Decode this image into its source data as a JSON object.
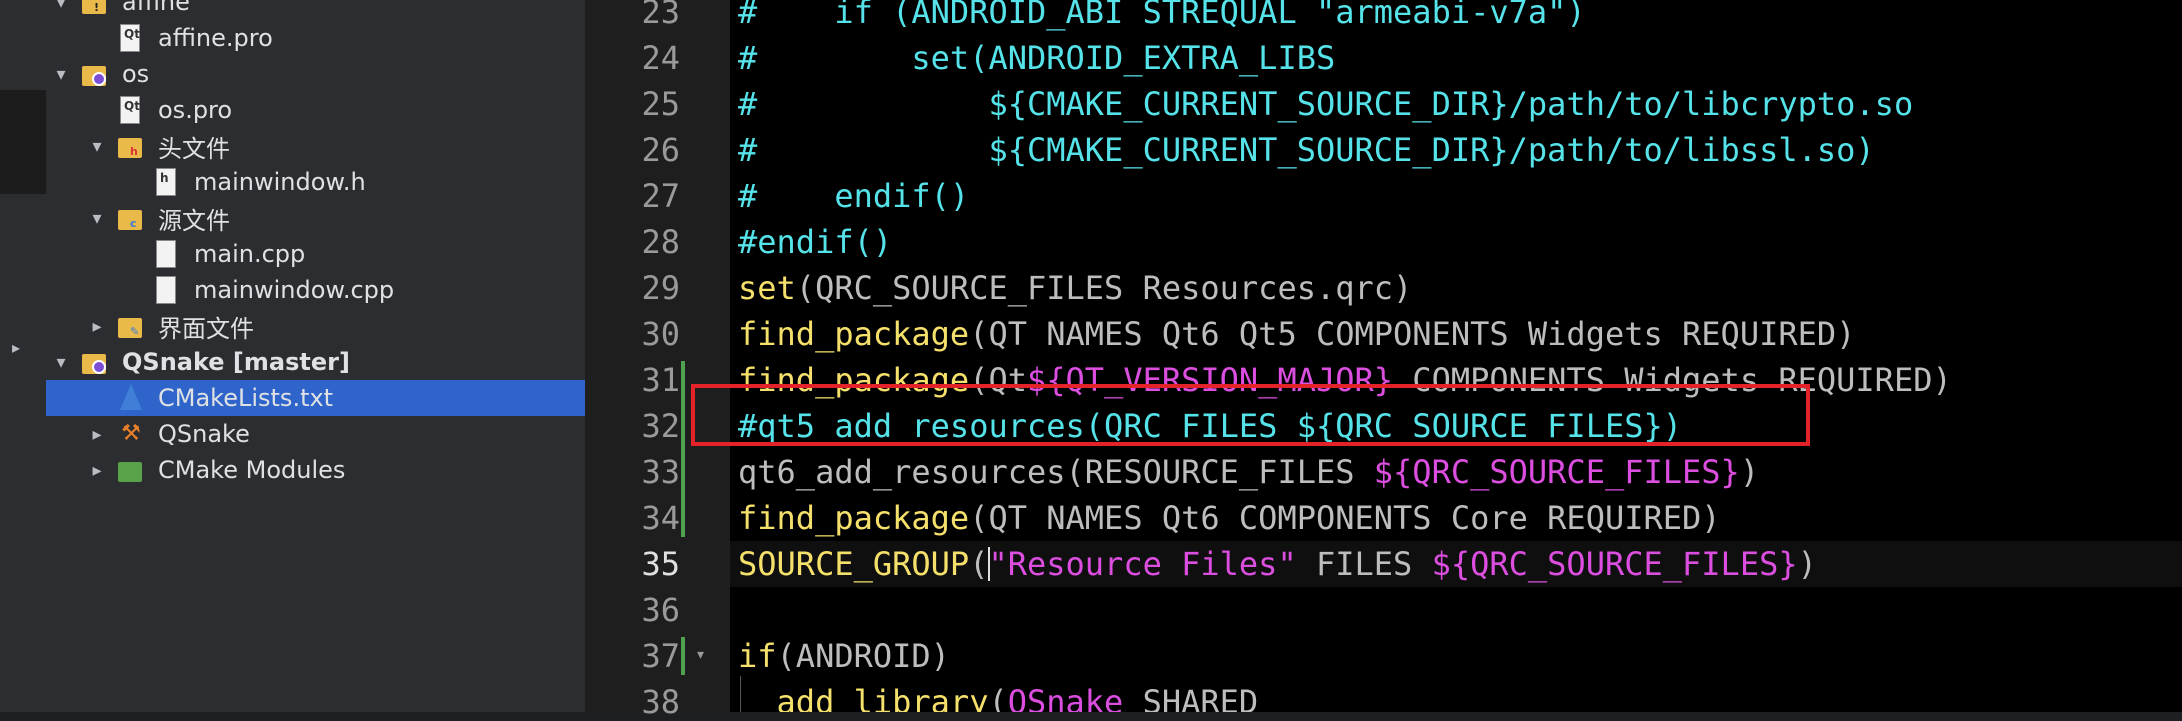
{
  "project_tree": {
    "items": [
      {
        "label": "affine",
        "icon": "folder-warning-icon",
        "arrow": "▾",
        "indent": 0,
        "bold": false
      },
      {
        "label": "affine.pro",
        "icon": "qt-project-file-icon",
        "arrow": "",
        "indent": 1,
        "bold": false
      },
      {
        "label": "os",
        "icon": "project-icon",
        "arrow": "▾",
        "indent": 0,
        "bold": false
      },
      {
        "label": "os.pro",
        "icon": "qt-project-file-icon",
        "arrow": "",
        "indent": 1,
        "bold": false
      },
      {
        "label": "头文件",
        "icon": "header-folder-icon",
        "arrow": "▾",
        "indent": 1,
        "bold": false
      },
      {
        "label": "mainwindow.h",
        "icon": "header-file-icon",
        "arrow": "",
        "indent": 2,
        "bold": false
      },
      {
        "label": "源文件",
        "icon": "source-folder-icon",
        "arrow": "▾",
        "indent": 1,
        "bold": false
      },
      {
        "label": "main.cpp",
        "icon": "cpp-file-icon",
        "arrow": "",
        "indent": 2,
        "bold": false
      },
      {
        "label": "mainwindow.cpp",
        "icon": "cpp-file-icon",
        "arrow": "",
        "indent": 2,
        "bold": false
      },
      {
        "label": "界面文件",
        "icon": "forms-folder-icon",
        "arrow": "▸",
        "indent": 1,
        "bold": false
      },
      {
        "label": "QSnake [master]",
        "icon": "project-icon",
        "arrow": "▾",
        "indent": 0,
        "bold": true
      },
      {
        "label": "CMakeLists.txt",
        "icon": "cmake-file-icon",
        "arrow": "",
        "indent": 1,
        "bold": false,
        "selected": true
      },
      {
        "label": "QSnake",
        "icon": "hammer-icon",
        "arrow": "▸",
        "indent": 1,
        "bold": false
      },
      {
        "label": "CMake Modules",
        "icon": "cmake-modules-icon",
        "arrow": "▸",
        "indent": 1,
        "bold": false
      }
    ]
  },
  "editor": {
    "current_line": 35,
    "lines": [
      {
        "num": "23",
        "tokens": [
          {
            "t": "#    if (ANDROID_ABI STREQUAL \"armeabi-v7a\")",
            "c": "cm"
          }
        ]
      },
      {
        "num": "24",
        "tokens": [
          {
            "t": "#        set(ANDROID_EXTRA_LIBS",
            "c": "cm"
          }
        ]
      },
      {
        "num": "25",
        "tokens": [
          {
            "t": "#            ${CMAKE_CURRENT_SOURCE_DIR}/path/to/libcrypto.so",
            "c": "cm"
          }
        ]
      },
      {
        "num": "26",
        "tokens": [
          {
            "t": "#            ${CMAKE_CURRENT_SOURCE_DIR}/path/to/libssl.so)",
            "c": "cm"
          }
        ]
      },
      {
        "num": "27",
        "tokens": [
          {
            "t": "#    endif()",
            "c": "cm"
          }
        ]
      },
      {
        "num": "28",
        "tokens": [
          {
            "t": "#endif()",
            "c": "cm"
          }
        ]
      },
      {
        "num": "29",
        "tokens": [
          {
            "t": "set",
            "c": "kw"
          },
          {
            "t": "(QRC_SOURCE_FILES Resources.qrc)",
            "c": "pl"
          }
        ]
      },
      {
        "num": "30",
        "tokens": [
          {
            "t": "find_package",
            "c": "kw"
          },
          {
            "t": "(QT NAMES Qt6 Qt5 COMPONENTS Widgets REQUIRED)",
            "c": "pl"
          }
        ]
      },
      {
        "num": "31",
        "tokens": [
          {
            "t": "find_package",
            "c": "kw"
          },
          {
            "t": "(Qt",
            "c": "pl"
          },
          {
            "t": "${QT_VERSION_MAJOR}",
            "c": "var"
          },
          {
            "t": " COMPONENTS Widgets REQUIRED)",
            "c": "pl"
          }
        ]
      },
      {
        "num": "32",
        "tokens": [
          {
            "t": "#qt5_add_resources(QRC_FILES ${QRC_SOURCE_FILES})",
            "c": "cm"
          }
        ]
      },
      {
        "num": "33",
        "tokens": [
          {
            "t": "qt6_add_resources(RESOURCE_FILES ",
            "c": "pl"
          },
          {
            "t": "${QRC_SOURCE_FILES}",
            "c": "var"
          },
          {
            "t": ")",
            "c": "pl"
          }
        ]
      },
      {
        "num": "34",
        "tokens": [
          {
            "t": "find_package",
            "c": "kw"
          },
          {
            "t": "(QT NAMES Qt6 COMPONENTS Core REQUIRED)",
            "c": "pl"
          }
        ]
      },
      {
        "num": "35",
        "tokens": [
          {
            "t": "SOURCE_GROUP",
            "c": "kw"
          },
          {
            "t": "(",
            "c": "pl"
          },
          {
            "t": "\"Resource Files\"",
            "c": "str"
          },
          {
            "t": " FILES ",
            "c": "pl"
          },
          {
            "t": "${QRC_SOURCE_FILES}",
            "c": "var"
          },
          {
            "t": ")",
            "c": "pl"
          }
        ]
      },
      {
        "num": "36",
        "tokens": []
      },
      {
        "num": "37",
        "tokens": [
          {
            "t": "if",
            "c": "kw"
          },
          {
            "t": "(ANDROID)",
            "c": "pl"
          }
        ]
      },
      {
        "num": "38",
        "tokens": [
          {
            "t": "  add_library",
            "c": "kw"
          },
          {
            "t": "(",
            "c": "pl"
          },
          {
            "t": "QSnake",
            "c": "var"
          },
          {
            "t": " SHARED",
            "c": "pl"
          }
        ]
      }
    ]
  },
  "colors": {
    "comment": "#55e3e9",
    "keyword": "#f5e06b",
    "variable": "#dc4ee0",
    "plain": "#bdbdbd",
    "selection": "#2f65ca",
    "highlight_box": "#e3222a",
    "change_bar": "#4fa34f"
  }
}
